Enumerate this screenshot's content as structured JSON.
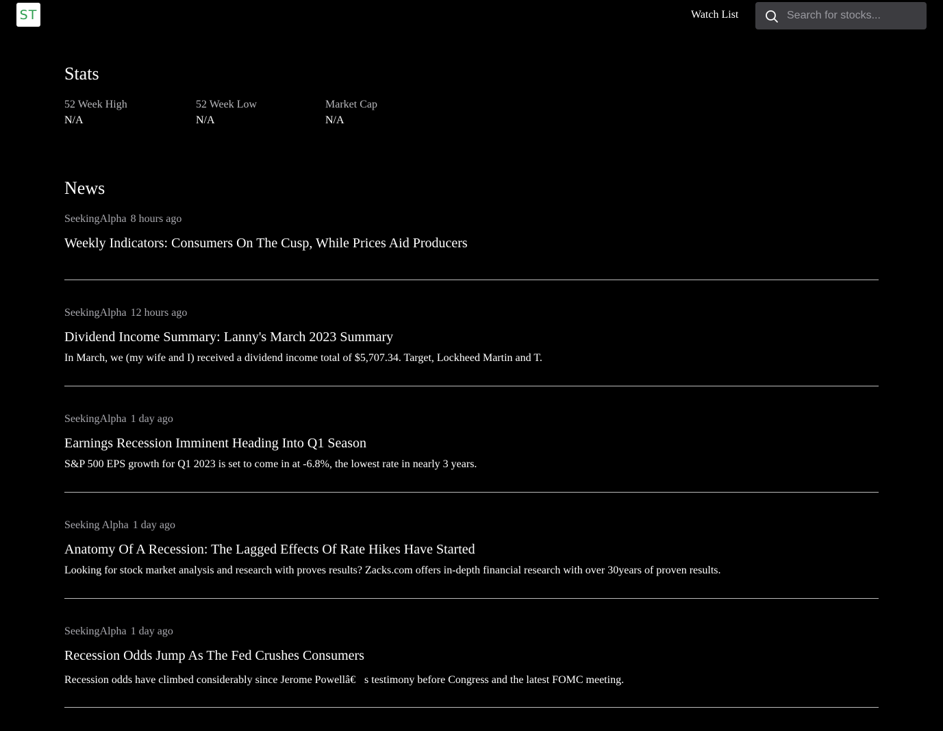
{
  "header": {
    "logo_text": "ST",
    "watchlist_label": "Watch List",
    "search_placeholder": "Search for stocks..."
  },
  "stats": {
    "title": "Stats",
    "items": [
      {
        "label": "52 Week High",
        "value": "N/A"
      },
      {
        "label": "52 Week Low",
        "value": "N/A"
      },
      {
        "label": "Market Cap",
        "value": "N/A"
      }
    ]
  },
  "news": {
    "title": "News",
    "items": [
      {
        "source": "SeekingAlpha",
        "time": "8 hours ago",
        "headline": "Weekly Indicators: Consumers On The Cusp, While Prices Aid Producers",
        "summary": ""
      },
      {
        "source": "SeekingAlpha",
        "time": "12 hours ago",
        "headline": "Dividend Income Summary: Lanny's March 2023 Summary",
        "summary": "In March, we (my wife and I) received a dividend income total of $5,707.34. Target, Lockheed Martin and T."
      },
      {
        "source": "SeekingAlpha",
        "time": "1 day ago",
        "headline": "Earnings Recession Imminent Heading Into Q1 Season",
        "summary": "S&P 500 EPS growth for Q1 2023 is set to come in at -6.8%, the lowest rate in nearly 3 years."
      },
      {
        "source": "Seeking Alpha",
        "time": "1 day ago",
        "headline": "Anatomy Of A Recession: The Lagged Effects Of Rate Hikes Have Started",
        "summary": "Looking for stock market analysis and research with proves results? Zacks.com offers in-depth financial research with over 30years of proven results."
      },
      {
        "source": "SeekingAlpha",
        "time": "1 day ago",
        "headline": "Recession Odds Jump As The Fed Crushes Consumers",
        "summary": "Recession odds have climbed considerably since Jerome Powellâ€s testimony before Congress and the latest FOMC meeting."
      }
    ]
  }
}
